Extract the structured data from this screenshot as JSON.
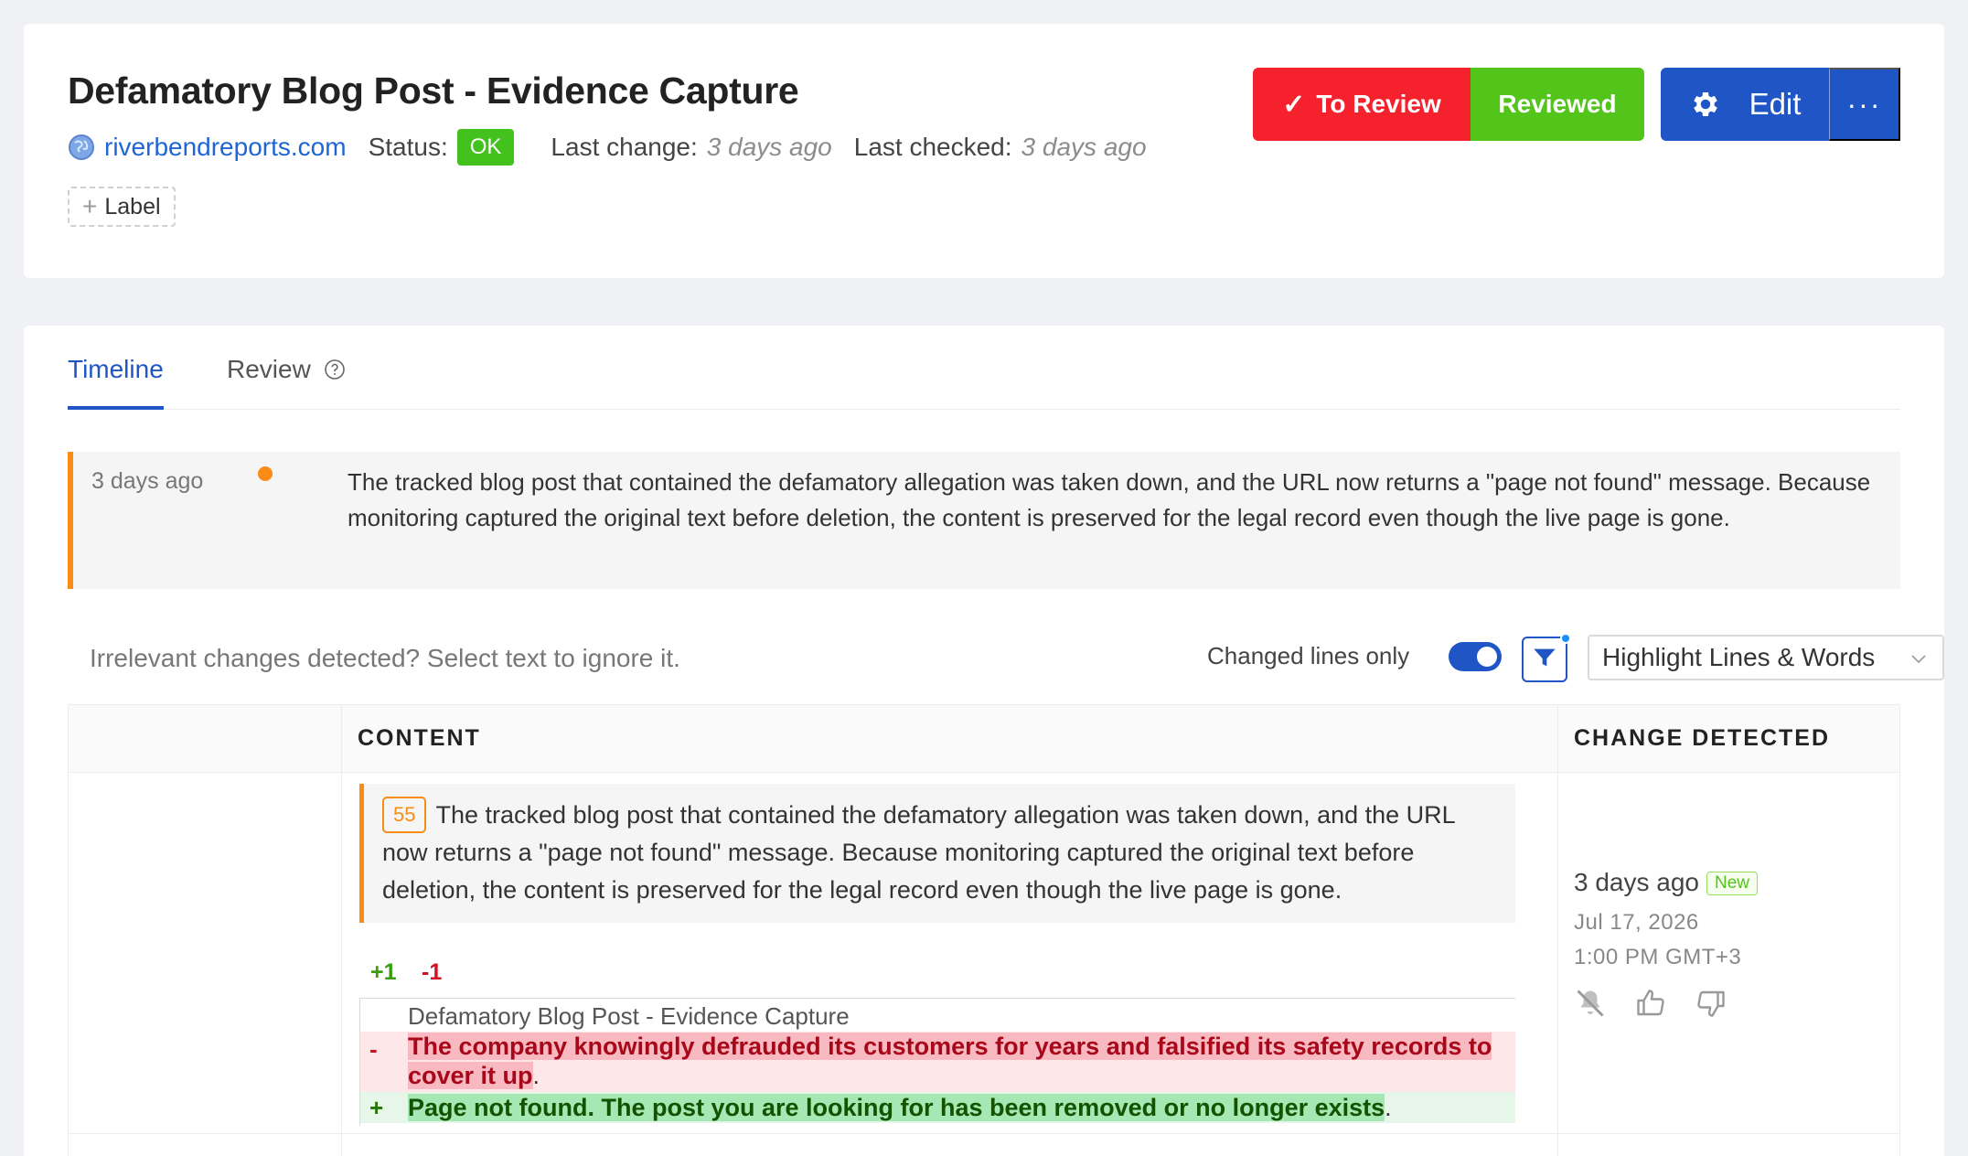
{
  "header": {
    "title": "Defamatory Blog Post - Evidence Capture",
    "site": "riverbendreports.com",
    "status_label": "Status:",
    "status_value": "OK",
    "last_change_label": "Last change:",
    "last_change_value": "3 days ago",
    "last_checked_label": "Last checked:",
    "last_checked_value": "3 days ago",
    "label_button": "Label",
    "to_review_label": "To Review",
    "reviewed_label": "Reviewed",
    "edit_label": "Edit",
    "more_label": "···"
  },
  "tabs": [
    {
      "label": "Timeline",
      "active": true
    },
    {
      "label": "Review",
      "active": false
    }
  ],
  "event": {
    "time": "3 days ago",
    "text": "The tracked blog post that contained the defamatory allegation was taken down, and the URL now returns a \"page not found\" message. Because monitoring captured the original text before deletion, the content is preserved for the legal record even though the live page is gone."
  },
  "filters": {
    "hint": "Irrelevant changes detected? Select text to ignore it.",
    "changed_lines_label": "Changed lines only",
    "changed_lines_on": true,
    "highlight_mode": "Highlight Lines & Words"
  },
  "table": {
    "columns": [
      "",
      "CONTENT",
      "CHANGE DETECTED"
    ],
    "rows": [
      {
        "line_number": "55",
        "summary": "The tracked blog post that contained the defamatory allegation was taken down, and the URL now returns a \"page not found\" message. Because monitoring captured the original text before deletion, the content is preserved for the legal record even though the live page is gone.",
        "added_count": "+1",
        "removed_count": "-1",
        "context_line": "Defamatory Blog Post - Evidence Capture",
        "removed_marker": "-",
        "removed_text": "The company knowingly defrauded its customers for years and falsified its safety records to cover it up",
        "removed_trailing": ".",
        "added_marker": "+",
        "added_text": "Page not found. The post you are looking for has been removed or no longer exists",
        "added_trailing": ".",
        "detected_relative": "3 days ago",
        "detected_badge": "New",
        "detected_date": "Jul 17, 2026",
        "detected_time": "1:00 PM GMT+3"
      }
    ]
  },
  "colors": {
    "primary": "#1f55c4",
    "to_review": "#f5222d",
    "reviewed": "#52c41a",
    "status_ok": "#43c11c",
    "accent_orange": "#fa8c16"
  }
}
